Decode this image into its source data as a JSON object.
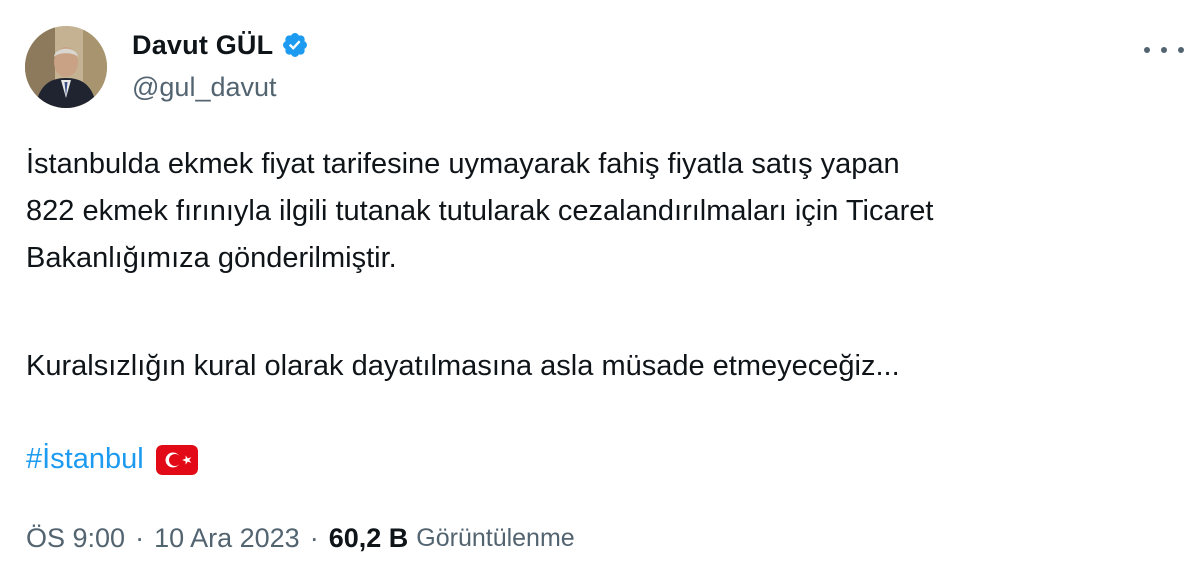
{
  "author": {
    "name": "Davut GÜL",
    "handle": "@gul_davut"
  },
  "tweet": {
    "lines": [
      "İstanbulda ekmek fiyat tarifesine uymayarak fahiş fiyatla satış yapan",
      "822 ekmek fırınıyla ilgili tutanak tutularak cezalandırılmaları için Ticaret",
      "Bakanlığımıza gönderilmiştir."
    ],
    "second_paragraph": "Kuralsızlığın kural olarak dayatılmasına asla müsade etmeyeceğiz...",
    "hashtag": "#İstanbul"
  },
  "meta": {
    "time": "ÖS 9:00",
    "separator": "·",
    "date": "10 Ara 2023",
    "views_count": "60,2 B",
    "views_label": "Görüntülenme"
  },
  "icons": {
    "verified": "verified-badge-icon",
    "more": "more-options-icon",
    "flag": "turkey-flag-emoji"
  },
  "colors": {
    "link": "#1d9bf0",
    "secondary_text": "#536471",
    "primary_text": "#0f1419",
    "flag_red": "#e30a17"
  }
}
